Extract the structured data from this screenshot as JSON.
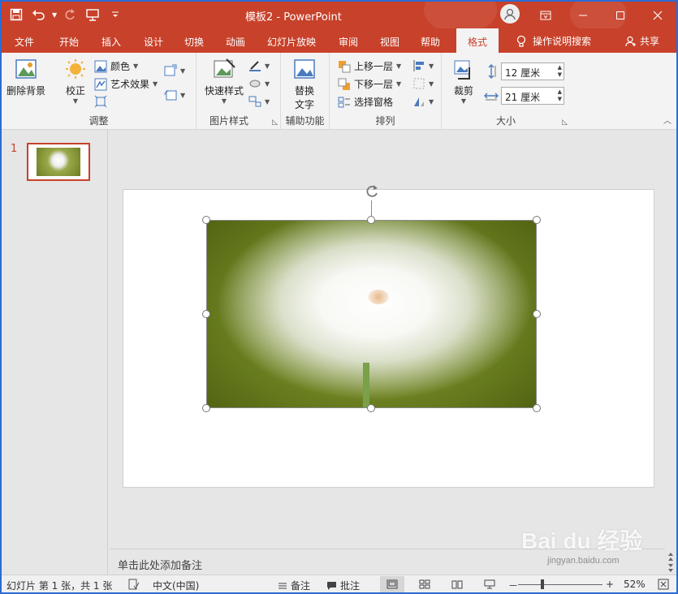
{
  "window": {
    "title": "模板2 - PowerPoint"
  },
  "tabs": [
    {
      "label": "文件"
    },
    {
      "label": "开始"
    },
    {
      "label": "插入"
    },
    {
      "label": "设计"
    },
    {
      "label": "切换"
    },
    {
      "label": "动画"
    },
    {
      "label": "幻灯片放映"
    },
    {
      "label": "审阅"
    },
    {
      "label": "视图"
    },
    {
      "label": "帮助"
    },
    {
      "label": "格式",
      "active": true
    }
  ],
  "tell_me": "操作说明搜索",
  "share": "共享",
  "ribbon": {
    "adjust": {
      "remove_bg": "删除背景",
      "corrections": "校正",
      "color": "颜色",
      "artistic": "艺术效果",
      "group_label": "调整"
    },
    "picture_styles": {
      "quick_styles": "快速样式",
      "group_label": "图片样式"
    },
    "accessibility": {
      "alt_text_line1": "替换",
      "alt_text_line2": "文字",
      "group_label": "辅助功能"
    },
    "arrange": {
      "bring_forward": "上移一层",
      "send_backward": "下移一层",
      "selection_pane": "选择窗格",
      "group_label": "排列"
    },
    "size": {
      "crop": "裁剪",
      "height": "12 厘米",
      "width": "21 厘米",
      "group_label": "大小"
    }
  },
  "slides_pane": {
    "slide_number": "1"
  },
  "notes": {
    "placeholder": "单击此处添加备注"
  },
  "status": {
    "slide_info": "幻灯片 第 1 张，共 1 张",
    "language": "中文(中国)",
    "notes_btn": "备注",
    "comments_btn": "批注",
    "zoom_minus": "－",
    "zoom_plus": "+",
    "zoom_level": "52%"
  },
  "watermark": {
    "text": "Bai du 经验",
    "sub": "jingyan.baidu.com"
  },
  "colors": {
    "accent": "#c8412a",
    "window_border": "#2b6cd4"
  }
}
